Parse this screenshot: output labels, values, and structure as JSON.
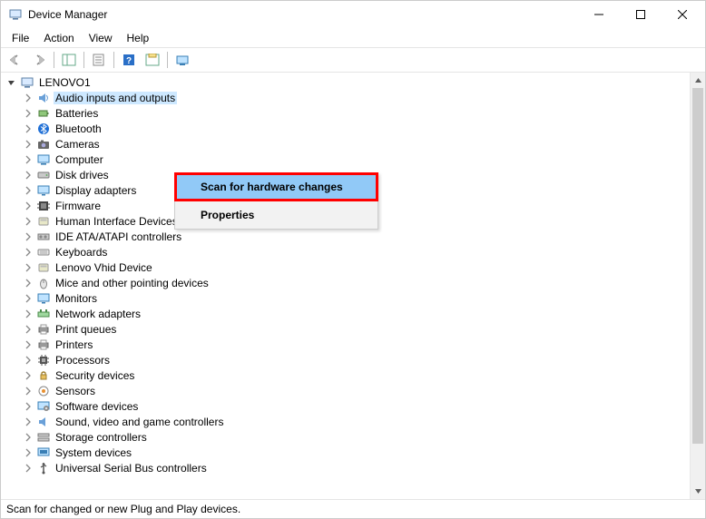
{
  "window": {
    "title": "Device Manager"
  },
  "menubar": {
    "items": [
      "File",
      "Action",
      "View",
      "Help"
    ]
  },
  "tree": {
    "root": {
      "label": "LENOVO1",
      "icon": "computer-root"
    },
    "categories": [
      {
        "label": "Audio inputs and outputs",
        "icon": "audio",
        "selected": true
      },
      {
        "label": "Batteries",
        "icon": "battery"
      },
      {
        "label": "Bluetooth",
        "icon": "bluetooth"
      },
      {
        "label": "Cameras",
        "icon": "camera"
      },
      {
        "label": "Computer",
        "icon": "computer"
      },
      {
        "label": "Disk drives",
        "icon": "disk"
      },
      {
        "label": "Display adapters",
        "icon": "display"
      },
      {
        "label": "Firmware",
        "icon": "firmware"
      },
      {
        "label": "Human Interface Devices",
        "icon": "hid"
      },
      {
        "label": "IDE ATA/ATAPI controllers",
        "icon": "ide"
      },
      {
        "label": "Keyboards",
        "icon": "keyboard"
      },
      {
        "label": "Lenovo Vhid Device",
        "icon": "hid"
      },
      {
        "label": "Mice and other pointing devices",
        "icon": "mouse"
      },
      {
        "label": "Monitors",
        "icon": "monitor"
      },
      {
        "label": "Network adapters",
        "icon": "network"
      },
      {
        "label": "Print queues",
        "icon": "printer"
      },
      {
        "label": "Printers",
        "icon": "printer"
      },
      {
        "label": "Processors",
        "icon": "processor"
      },
      {
        "label": "Security devices",
        "icon": "security"
      },
      {
        "label": "Sensors",
        "icon": "sensor"
      },
      {
        "label": "Software devices",
        "icon": "software"
      },
      {
        "label": "Sound, video and game controllers",
        "icon": "sound"
      },
      {
        "label": "Storage controllers",
        "icon": "storage"
      },
      {
        "label": "System devices",
        "icon": "system"
      },
      {
        "label": "Universal Serial Bus controllers",
        "icon": "usb"
      }
    ]
  },
  "context_menu": {
    "items": [
      {
        "label": "Scan for hardware changes",
        "highlighted": true
      },
      {
        "label": "Properties",
        "bold": true
      }
    ]
  },
  "statusbar": {
    "text": "Scan for changed or new Plug and Play devices."
  }
}
